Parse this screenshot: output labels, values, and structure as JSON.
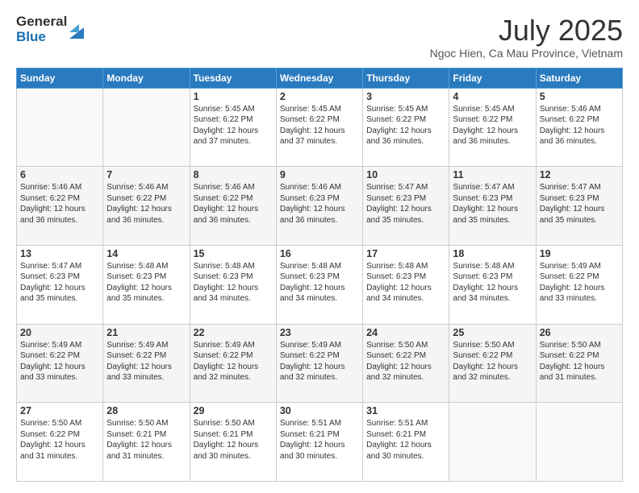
{
  "logo": {
    "general": "General",
    "blue": "Blue"
  },
  "header": {
    "month": "July 2025",
    "location": "Ngoc Hien, Ca Mau Province, Vietnam"
  },
  "days_of_week": [
    "Sunday",
    "Monday",
    "Tuesday",
    "Wednesday",
    "Thursday",
    "Friday",
    "Saturday"
  ],
  "weeks": [
    [
      {
        "day": "",
        "sunrise": "",
        "sunset": "",
        "daylight": ""
      },
      {
        "day": "",
        "sunrise": "",
        "sunset": "",
        "daylight": ""
      },
      {
        "day": "1",
        "sunrise": "Sunrise: 5:45 AM",
        "sunset": "Sunset: 6:22 PM",
        "daylight": "Daylight: 12 hours and 37 minutes."
      },
      {
        "day": "2",
        "sunrise": "Sunrise: 5:45 AM",
        "sunset": "Sunset: 6:22 PM",
        "daylight": "Daylight: 12 hours and 37 minutes."
      },
      {
        "day": "3",
        "sunrise": "Sunrise: 5:45 AM",
        "sunset": "Sunset: 6:22 PM",
        "daylight": "Daylight: 12 hours and 36 minutes."
      },
      {
        "day": "4",
        "sunrise": "Sunrise: 5:45 AM",
        "sunset": "Sunset: 6:22 PM",
        "daylight": "Daylight: 12 hours and 36 minutes."
      },
      {
        "day": "5",
        "sunrise": "Sunrise: 5:46 AM",
        "sunset": "Sunset: 6:22 PM",
        "daylight": "Daylight: 12 hours and 36 minutes."
      }
    ],
    [
      {
        "day": "6",
        "sunrise": "Sunrise: 5:46 AM",
        "sunset": "Sunset: 6:22 PM",
        "daylight": "Daylight: 12 hours and 36 minutes."
      },
      {
        "day": "7",
        "sunrise": "Sunrise: 5:46 AM",
        "sunset": "Sunset: 6:22 PM",
        "daylight": "Daylight: 12 hours and 36 minutes."
      },
      {
        "day": "8",
        "sunrise": "Sunrise: 5:46 AM",
        "sunset": "Sunset: 6:22 PM",
        "daylight": "Daylight: 12 hours and 36 minutes."
      },
      {
        "day": "9",
        "sunrise": "Sunrise: 5:46 AM",
        "sunset": "Sunset: 6:23 PM",
        "daylight": "Daylight: 12 hours and 36 minutes."
      },
      {
        "day": "10",
        "sunrise": "Sunrise: 5:47 AM",
        "sunset": "Sunset: 6:23 PM",
        "daylight": "Daylight: 12 hours and 35 minutes."
      },
      {
        "day": "11",
        "sunrise": "Sunrise: 5:47 AM",
        "sunset": "Sunset: 6:23 PM",
        "daylight": "Daylight: 12 hours and 35 minutes."
      },
      {
        "day": "12",
        "sunrise": "Sunrise: 5:47 AM",
        "sunset": "Sunset: 6:23 PM",
        "daylight": "Daylight: 12 hours and 35 minutes."
      }
    ],
    [
      {
        "day": "13",
        "sunrise": "Sunrise: 5:47 AM",
        "sunset": "Sunset: 6:23 PM",
        "daylight": "Daylight: 12 hours and 35 minutes."
      },
      {
        "day": "14",
        "sunrise": "Sunrise: 5:48 AM",
        "sunset": "Sunset: 6:23 PM",
        "daylight": "Daylight: 12 hours and 35 minutes."
      },
      {
        "day": "15",
        "sunrise": "Sunrise: 5:48 AM",
        "sunset": "Sunset: 6:23 PM",
        "daylight": "Daylight: 12 hours and 34 minutes."
      },
      {
        "day": "16",
        "sunrise": "Sunrise: 5:48 AM",
        "sunset": "Sunset: 6:23 PM",
        "daylight": "Daylight: 12 hours and 34 minutes."
      },
      {
        "day": "17",
        "sunrise": "Sunrise: 5:48 AM",
        "sunset": "Sunset: 6:23 PM",
        "daylight": "Daylight: 12 hours and 34 minutes."
      },
      {
        "day": "18",
        "sunrise": "Sunrise: 5:48 AM",
        "sunset": "Sunset: 6:23 PM",
        "daylight": "Daylight: 12 hours and 34 minutes."
      },
      {
        "day": "19",
        "sunrise": "Sunrise: 5:49 AM",
        "sunset": "Sunset: 6:22 PM",
        "daylight": "Daylight: 12 hours and 33 minutes."
      }
    ],
    [
      {
        "day": "20",
        "sunrise": "Sunrise: 5:49 AM",
        "sunset": "Sunset: 6:22 PM",
        "daylight": "Daylight: 12 hours and 33 minutes."
      },
      {
        "day": "21",
        "sunrise": "Sunrise: 5:49 AM",
        "sunset": "Sunset: 6:22 PM",
        "daylight": "Daylight: 12 hours and 33 minutes."
      },
      {
        "day": "22",
        "sunrise": "Sunrise: 5:49 AM",
        "sunset": "Sunset: 6:22 PM",
        "daylight": "Daylight: 12 hours and 32 minutes."
      },
      {
        "day": "23",
        "sunrise": "Sunrise: 5:49 AM",
        "sunset": "Sunset: 6:22 PM",
        "daylight": "Daylight: 12 hours and 32 minutes."
      },
      {
        "day": "24",
        "sunrise": "Sunrise: 5:50 AM",
        "sunset": "Sunset: 6:22 PM",
        "daylight": "Daylight: 12 hours and 32 minutes."
      },
      {
        "day": "25",
        "sunrise": "Sunrise: 5:50 AM",
        "sunset": "Sunset: 6:22 PM",
        "daylight": "Daylight: 12 hours and 32 minutes."
      },
      {
        "day": "26",
        "sunrise": "Sunrise: 5:50 AM",
        "sunset": "Sunset: 6:22 PM",
        "daylight": "Daylight: 12 hours and 31 minutes."
      }
    ],
    [
      {
        "day": "27",
        "sunrise": "Sunrise: 5:50 AM",
        "sunset": "Sunset: 6:22 PM",
        "daylight": "Daylight: 12 hours and 31 minutes."
      },
      {
        "day": "28",
        "sunrise": "Sunrise: 5:50 AM",
        "sunset": "Sunset: 6:21 PM",
        "daylight": "Daylight: 12 hours and 31 minutes."
      },
      {
        "day": "29",
        "sunrise": "Sunrise: 5:50 AM",
        "sunset": "Sunset: 6:21 PM",
        "daylight": "Daylight: 12 hours and 30 minutes."
      },
      {
        "day": "30",
        "sunrise": "Sunrise: 5:51 AM",
        "sunset": "Sunset: 6:21 PM",
        "daylight": "Daylight: 12 hours and 30 minutes."
      },
      {
        "day": "31",
        "sunrise": "Sunrise: 5:51 AM",
        "sunset": "Sunset: 6:21 PM",
        "daylight": "Daylight: 12 hours and 30 minutes."
      },
      {
        "day": "",
        "sunrise": "",
        "sunset": "",
        "daylight": ""
      },
      {
        "day": "",
        "sunrise": "",
        "sunset": "",
        "daylight": ""
      }
    ]
  ]
}
